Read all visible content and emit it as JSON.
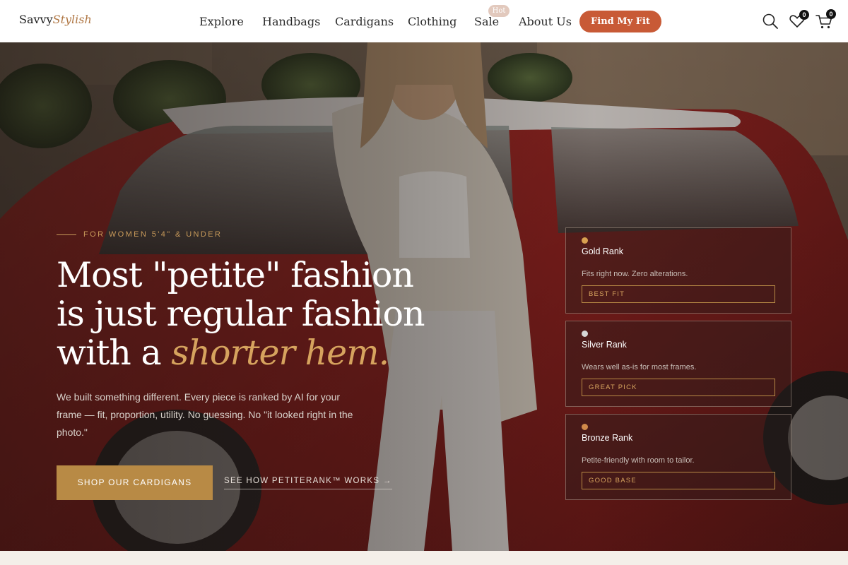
{
  "brand": {
    "name_plain": "Savvy",
    "name_script": "Stylish"
  },
  "nav": {
    "items": [
      {
        "label": "Explore"
      },
      {
        "label": "Handbags"
      },
      {
        "label": "Cardigans"
      },
      {
        "label": "Clothing"
      },
      {
        "label": "Sale",
        "badge": "Hot"
      },
      {
        "label": "About Us"
      }
    ],
    "cta_label": "Find My Fit"
  },
  "header_icons": {
    "search": "search-icon",
    "wishlist": "heart-icon",
    "wishlist_count": "0",
    "cart": "cart-icon",
    "cart_count": "0"
  },
  "hero": {
    "eyebrow": "FOR WOMEN 5'4\" & UNDER",
    "headline_line1": "Most \"petite\" fashion",
    "headline_line2": "is just regular fashion",
    "headline_line3_plain": "with a ",
    "headline_line3_accent": "shorter hem.",
    "body": "We built something different. Every piece is ranked by AI for your frame — fit, proportion, utility. No guessing. No \"it looked right in the photo.\"",
    "primary_cta": "SHOP OUR CARDIGANS",
    "secondary_cta": "SEE HOW PETITERANK™ WORKS →"
  },
  "ranks": [
    {
      "title": "Gold Rank",
      "desc": "Fits right now. Zero alterations.",
      "tag": "BEST FIT",
      "dot_color": "#d8a050"
    },
    {
      "title": "Silver Rank",
      "desc": "Wears well as-is for most frames.",
      "tag": "GREAT PICK",
      "dot_color": "#d6d6d6"
    },
    {
      "title": "Bronze Rank",
      "desc": "Petite-friendly with room to tailor.",
      "tag": "GOOD BASE",
      "dot_color": "#d28a4a"
    }
  ],
  "colors": {
    "accent": "#c85a36",
    "gold": "#b88a45",
    "header_bg": "#ffffff"
  }
}
